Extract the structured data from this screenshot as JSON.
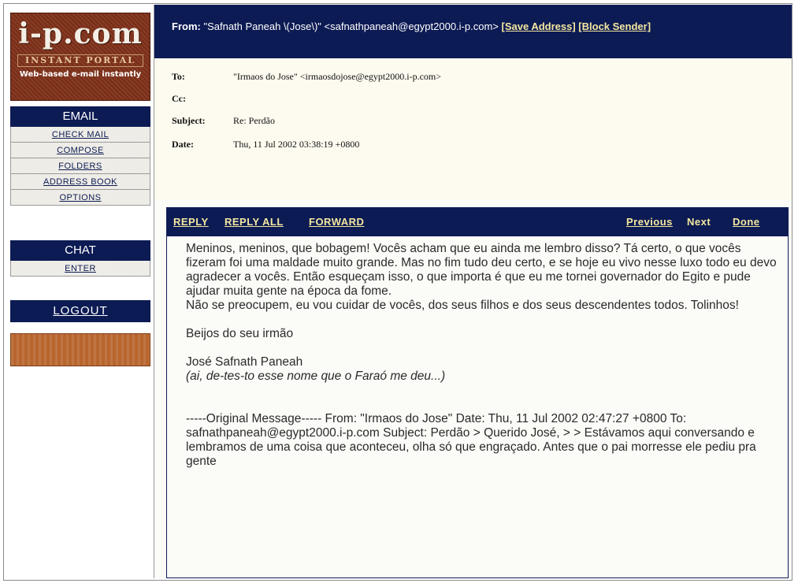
{
  "logo": {
    "brand": "i-p.com",
    "tagline": "INSTANT PORTAL",
    "subtitle": "Web-based e-mail instantly"
  },
  "sidebar": {
    "email_heading": "EMAIL",
    "email_items": [
      "CHECK MAIL",
      "COMPOSE",
      "FOLDERS",
      "ADDRESS BOOK",
      "OPTIONS"
    ],
    "chat_heading": "CHAT",
    "chat_items": [
      "ENTER"
    ],
    "logout": "LOGOUT"
  },
  "from_bar": {
    "label": "From:",
    "value": "\"Safnath Paneah \\(Jose\\)\" <safnathpaneah@egypt2000.i-p.com>",
    "save_address": "[Save Address]",
    "block_sender": "[Block Sender]"
  },
  "headers": {
    "to_label": "To:",
    "to_value": "\"Irmaos do Jose\" <irmaosdojose@egypt2000.i-p.com>",
    "cc_label": "Cc:",
    "cc_value": "",
    "subject_label": "Subject:",
    "subject_value": "Re: Perdão",
    "date_label": "Date:",
    "date_value": "Thu, 11 Jul 2002 03:38:19 +0800"
  },
  "toolbar": {
    "reply": "REPLY",
    "reply_all": "REPLY ALL",
    "forward": "FORWARD",
    "previous": "Previous",
    "next": "Next",
    "done": "Done"
  },
  "message": {
    "para1": "Meninos, meninos, que bobagem! Vocês acham que eu ainda me lembro disso? Tá certo, o que vocês fizeram foi uma maldade muito grande. Mas no fim tudo deu certo, e se hoje eu vivo nesse luxo todo eu devo agradecer a vocês. Então esqueçam isso, o que importa é que eu me tornei governador do Egito e pude ajudar muita gente na época da fome.",
    "para2": "Não se preocupem, eu vou cuidar de vocês, dos seus filhos e dos seus descendentes todos. Tolinhos!",
    "closing": "Beijos do seu irmão",
    "signature_name": "José Safnath Paneah",
    "signature_note": "(ai, de-tes-to esse nome que o Faraó me deu...)",
    "original": "-----Original Message----- From: \"Irmaos do Jose\" Date: Thu, 11 Jul 2002 02:47:27 +0800 To: safnathpaneah@egypt2000.i-p.com Subject: Perdão > Querido José, > > Estávamos aqui conversando e lembramos de uma coisa que aconteceu, olha só que engraçado. Antes que o pai morresse ele pediu pra gente"
  },
  "colors": {
    "navy": "#0d1b54",
    "link_yellow": "#f4e8a0",
    "logo_brown": "#7a2d16"
  }
}
